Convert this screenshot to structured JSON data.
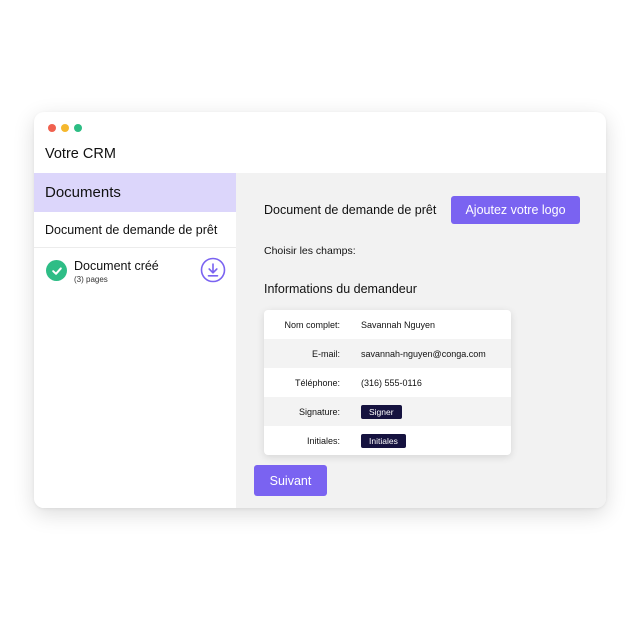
{
  "window": {
    "controls": [
      {
        "name": "close",
        "color": "#f0614f"
      },
      {
        "name": "minimize",
        "color": "#f5b82e"
      },
      {
        "name": "maximize",
        "color": "#2dbd84"
      }
    ],
    "title": "Votre CRM"
  },
  "sidebar": {
    "header": "Documents",
    "document_name": "Document de demande de prêt",
    "created": {
      "title": "Document créé",
      "pages": "(3) pages",
      "check_icon": "check-circle-icon",
      "download_icon": "download-icon"
    }
  },
  "main": {
    "document_title": "Document de demande de prêt",
    "logo_button": "Ajoutez votre logo",
    "choose_fields": "Choisir les champs:",
    "section_title": "Informations du demandeur",
    "fields": [
      {
        "label": "Nom complet:",
        "value": "Savannah Nguyen"
      },
      {
        "label": "E-mail:",
        "value": "savannah-nguyen@conga.com"
      },
      {
        "label": "Téléphone:",
        "value": "(316) 555-0116"
      },
      {
        "label": "Signature:",
        "tag": "Signer"
      },
      {
        "label": "Initiales:",
        "tag": "Initiales"
      }
    ],
    "next_button": "Suivant"
  },
  "colors": {
    "accent": "#7a63f1",
    "sidebar_header_bg": "#dcd6fb",
    "tag_bg": "#15123f",
    "success": "#2ebd86",
    "main_bg": "#f2f2f2"
  }
}
